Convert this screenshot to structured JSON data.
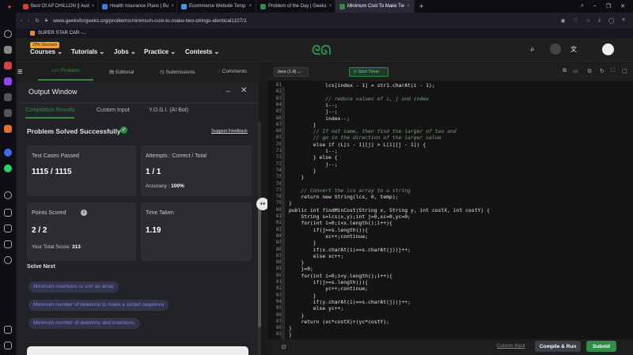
{
  "browser": {
    "tabs": [
      {
        "label": "Best Of AP DHILLON || Aud",
        "color": "#e23b3b"
      },
      {
        "label": "Health Insurance Plans | Bu",
        "color": "#3b7be2"
      },
      {
        "label": "Ecommerce Website Temp",
        "color": "#3b9ae2"
      },
      {
        "label": "Problem of the Day | Geeks",
        "color": "#2f8d46"
      },
      {
        "label": "Minimum Cost To Make Tw",
        "color": "#2f8d46"
      }
    ],
    "url": "www.geeksforgeeks.org/problems/minimum-cost-to-make-two-strings-identical1107/1",
    "bookmark": "SUPER STAR CAR -..."
  },
  "nav": {
    "discount_badge": "20% Discount",
    "items": [
      "Courses",
      "Tutorials",
      "Jobs",
      "Practice",
      "Contests"
    ],
    "logo": "GfG"
  },
  "panel": {
    "tabs": [
      "</> Problem",
      "Editorial",
      "Submissions",
      "Comments"
    ],
    "output_title": "Output Window",
    "output_tabs": [
      "Compilation Results",
      "Custom Input",
      "Y.O.G.I. (AI Bot)"
    ],
    "status": "Problem Solved Successfully",
    "feedback": "Suggest Feedback",
    "test_cases_label": "Test Cases Passed",
    "test_cases_value": "1115 / 1115",
    "attempts_label": "Attempts : Correct / Total",
    "attempts_value": "1 / 1",
    "accuracy_label": "Accuracy :",
    "accuracy_value": "100%",
    "points_label": "Points Scored",
    "points_value": "2 / 2",
    "total_score_label": "Your Total Score:",
    "total_score_value": "313",
    "time_label": "Time Taken",
    "time_value": "1.19",
    "solve_next_title": "Solve Next",
    "solve_next": [
      "Minimum insertions to sort an array",
      "Minimum number of deletions to make a sorted sequence",
      "Minimum number of deletions and insertions."
    ]
  },
  "editor": {
    "language": "Java (1.8)",
    "start_timer": "Start Timer",
    "lines": [
      {
        "n": "61",
        "text": "            lcs[index - 1] = str1.charAt(i - 1);",
        "cls": ""
      },
      {
        "n": "62",
        "text": "",
        "cls": ""
      },
      {
        "n": "63",
        "text": "            // reduce values of i, j and index",
        "cls": "cm"
      },
      {
        "n": "64",
        "text": "            i--;",
        "cls": ""
      },
      {
        "n": "65",
        "text": "            j--;",
        "cls": ""
      },
      {
        "n": "66",
        "text": "            index--;",
        "cls": ""
      },
      {
        "n": "67",
        "text": "        }",
        "cls": ""
      },
      {
        "n": "68",
        "text": "        // If not same, then find the larger of two and",
        "cls": "cm"
      },
      {
        "n": "69",
        "text": "        // go in the direction of the larger value",
        "cls": "cm"
      },
      {
        "n": "70",
        "text": "        else if (L[i - 1][j] > L[i][j - 1]) {",
        "cls": ""
      },
      {
        "n": "71",
        "text": "            i--;",
        "cls": ""
      },
      {
        "n": "72",
        "text": "        } else {",
        "cls": ""
      },
      {
        "n": "73",
        "text": "            j--;",
        "cls": ""
      },
      {
        "n": "74",
        "text": "        }",
        "cls": ""
      },
      {
        "n": "75",
        "text": "    }",
        "cls": ""
      },
      {
        "n": "76",
        "text": "",
        "cls": ""
      },
      {
        "n": "77",
        "text": "    // Convert the lcs array to a string",
        "cls": "cm"
      },
      {
        "n": "78",
        "text": "    return new String(lcs, 0, temp);",
        "cls": ""
      },
      {
        "n": "79",
        "text": "}",
        "cls": ""
      },
      {
        "n": "80",
        "text": "public int findMinCost(String x, String y, int costX, int costY) {",
        "cls": ""
      },
      {
        "n": "81",
        "text": "    String s=lcs(x,y);int j=0,xc=0,yc=0;",
        "cls": ""
      },
      {
        "n": "82",
        "text": "    for(int i=0;i<x.length();i++){",
        "cls": ""
      },
      {
        "n": "83",
        "text": "        if(j>=s.length()){",
        "cls": ""
      },
      {
        "n": "84",
        "text": "            xc++;continue;",
        "cls": ""
      },
      {
        "n": "85",
        "text": "        }",
        "cls": ""
      },
      {
        "n": "86",
        "text": "        if(x.charAt(i)==s.charAt(j))j++;",
        "cls": ""
      },
      {
        "n": "87",
        "text": "        else xc++;",
        "cls": ""
      },
      {
        "n": "88",
        "text": "    }",
        "cls": ""
      },
      {
        "n": "89",
        "text": "    j=0;",
        "cls": ""
      },
      {
        "n": "90",
        "text": "    for(int i=0;i<y.length();i++){",
        "cls": ""
      },
      {
        "n": "91",
        "text": "        if(j>=s.length()){",
        "cls": ""
      },
      {
        "n": "92",
        "text": "            yc++;continue;",
        "cls": ""
      },
      {
        "n": "93",
        "text": "        }",
        "cls": ""
      },
      {
        "n": "94",
        "text": "        if(y.charAt(i)==s.charAt(j))j++;",
        "cls": ""
      },
      {
        "n": "95",
        "text": "        else yc++;",
        "cls": ""
      },
      {
        "n": "96",
        "text": "    }",
        "cls": ""
      },
      {
        "n": "97",
        "text": "    return (xc*costX)+(yc*costY);",
        "cls": ""
      },
      {
        "n": "98",
        "text": "}",
        "cls": ""
      },
      {
        "n": "99",
        "text": "}",
        "cls": ""
      }
    ],
    "custom_input": "Custom Input",
    "compile_run": "Compile & Run",
    "submit": "Submit"
  },
  "colors": {
    "accent": "#2f8d46",
    "chip_text": "#7f86e0"
  }
}
